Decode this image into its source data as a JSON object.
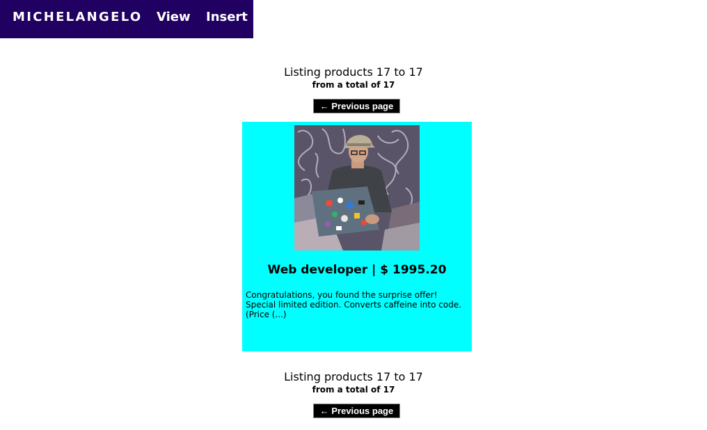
{
  "nav": {
    "brand": "MICHELANGELO",
    "links": [
      "View",
      "Insert"
    ]
  },
  "colors": {
    "navbar_bg": "#200060",
    "card_bg": "#00ffff",
    "button_bg": "#000000"
  },
  "listing_top": {
    "line1": "Listing products 17 to 17",
    "line2": "from a total of 17",
    "prev_button": "← Previous page"
  },
  "product": {
    "image_alt": "person working on laptop covered in stickers",
    "title": "Web developer | $ 1995.20",
    "description": "Congratulations, you found the surprise offer! Special limited edition. Converts caffeine into code. (Price (...)"
  },
  "listing_bottom": {
    "line1": "Listing products 17 to 17",
    "line2": "from a total of 17",
    "prev_button": "← Previous page"
  }
}
